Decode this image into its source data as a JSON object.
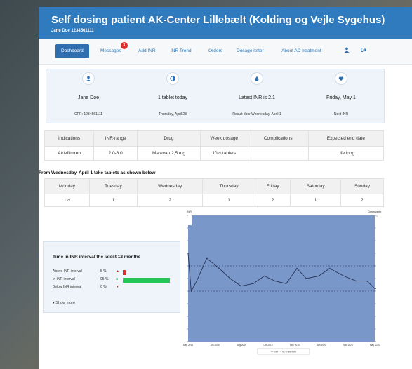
{
  "header": {
    "title": "Self dosing patient AK-Center Lillebælt (Kolding og Vejle Sygehus)",
    "subtitle": "Jane Doe 1234561111"
  },
  "nav": {
    "items": [
      "Dashboard",
      "Messages",
      "Add INR",
      "INR Trend",
      "Orders",
      "Dosage letter",
      "About AC treatment"
    ],
    "active": "Dashboard",
    "messages_badge": "3"
  },
  "icons": {
    "patient": "person-icon",
    "tablet": "half-circle-icon",
    "inr": "drop-icon",
    "next": "heart-icon",
    "user": "user-icon",
    "logout": "logout-icon",
    "show_more": "chevron-down-icon"
  },
  "cards": [
    {
      "main": "Jane Doe",
      "sub": "CPR: 1234561111"
    },
    {
      "main": "1 tablet today",
      "sub": "Thursday, April 23"
    },
    {
      "main": "Latest INR is 2.1",
      "sub": "Result date Wednesday, April 1"
    },
    {
      "main": "Friday, May 1",
      "sub": "Next INR"
    }
  ],
  "treatment_table": {
    "headers": [
      "Indications",
      "INR-range",
      "Drug",
      "Week dosage",
      "Complications",
      "Expected end date"
    ],
    "row": [
      "Atrieflimren",
      "2.0-3.0",
      "Marevan 2,5 mg",
      "10½ tablets",
      "",
      "Life long"
    ]
  },
  "schedule": {
    "label": "From Wednesday, April 1 take tablets as shown below",
    "days": [
      "Monday",
      "Tuesday",
      "Wednesday",
      "Thursday",
      "Friday",
      "Saturday",
      "Sunday"
    ],
    "values": [
      "1½",
      "1",
      "2",
      "1",
      "2",
      "1",
      "2"
    ]
  },
  "time_in_range": {
    "title": "Time in INR interval the latest 12 months",
    "rows": [
      {
        "label": "Above INR interval",
        "percent": "5 %",
        "value": 5,
        "color": "#d9302c"
      },
      {
        "label": "In INR interval",
        "percent": "95 %",
        "value": 95,
        "color": "#27c45a"
      },
      {
        "label": "Below INR interval",
        "percent": "0 %",
        "value": 0,
        "color": "#d9302c"
      }
    ],
    "show_more": "Show more"
  },
  "chart_data": {
    "type": "line",
    "y_left_label": "INR",
    "y_right_label": "Dosisweek",
    "y_right_top": "11",
    "x_ticks": [
      "May 2019",
      "Jun 2019",
      "Aug 2019",
      "Oct 2019",
      "Nov 2019",
      "Jan 2020",
      "Mar 2020",
      "May 2020"
    ],
    "ylim": [
      0,
      5
    ],
    "target_range": [
      2.0,
      3.0
    ],
    "background_color": "#7a97c9",
    "series": [
      {
        "name": "INR",
        "x": [
          0,
          0.2,
          0.55,
          1.2,
          2.0,
          2.7,
          3.4,
          4.2,
          4.9,
          5.6,
          6.3,
          7.0,
          7.6,
          8.4,
          9.1,
          10.0,
          10.8,
          11.5,
          12.0
        ],
        "y": [
          3.5,
          2.0,
          2.4,
          3.3,
          2.9,
          2.5,
          2.2,
          2.3,
          2.6,
          2.4,
          2.3,
          2.9,
          2.5,
          2.6,
          2.9,
          2.6,
          2.4,
          2.4,
          2.1
        ]
      },
      {
        "name": "TR",
        "color": "#3a3a3a"
      },
      {
        "name": "Warfarin"
      }
    ]
  }
}
